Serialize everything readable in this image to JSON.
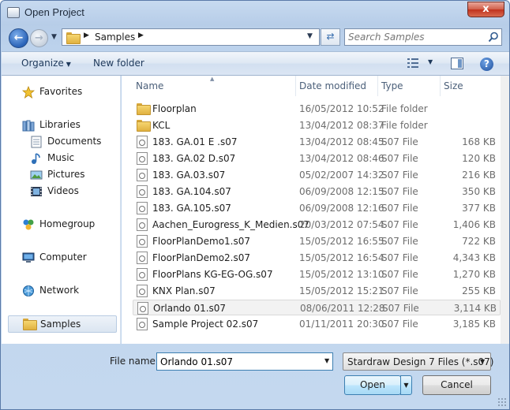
{
  "window": {
    "title": "Open Project",
    "close_label": "x"
  },
  "address": {
    "location": "Samples"
  },
  "search": {
    "placeholder": "Search Samples"
  },
  "toolbar": {
    "organize_label": "Organize",
    "new_folder_label": "New folder",
    "help_label": "?"
  },
  "nav": {
    "favorites": "Favorites",
    "libraries": "Libraries",
    "documents": "Documents",
    "music": "Music",
    "pictures": "Pictures",
    "videos": "Videos",
    "homegroup": "Homegroup",
    "computer": "Computer",
    "network": "Network",
    "samples": "Samples"
  },
  "columns": {
    "name": "Name",
    "date": "Date modified",
    "type": "Type",
    "size": "Size"
  },
  "files": [
    {
      "name": "Floorplan",
      "date": "16/05/2012 10:52",
      "type": "File folder",
      "size": "",
      "kind": "folder"
    },
    {
      "name": "KCL",
      "date": "13/04/2012 08:37",
      "type": "File folder",
      "size": "",
      "kind": "folder"
    },
    {
      "name": "183. GA.01 E .s07",
      "date": "13/04/2012 08:45",
      "type": "S07 File",
      "size": "168 KB",
      "kind": "file"
    },
    {
      "name": "183. GA.02 D.s07",
      "date": "13/04/2012 08:46",
      "type": "S07 File",
      "size": "120 KB",
      "kind": "file"
    },
    {
      "name": "183. GA.03.s07",
      "date": "05/02/2007 14:32",
      "type": "S07 File",
      "size": "216 KB",
      "kind": "file"
    },
    {
      "name": "183. GA.104.s07",
      "date": "06/09/2008 12:15",
      "type": "S07 File",
      "size": "350 KB",
      "kind": "file"
    },
    {
      "name": "183. GA.105.s07",
      "date": "06/09/2008 12:16",
      "type": "S07 File",
      "size": "377 KB",
      "kind": "file"
    },
    {
      "name": "Aachen_Eurogress_K_Medien.s07",
      "date": "20/03/2012 07:54",
      "type": "S07 File",
      "size": "1,406 KB",
      "kind": "file"
    },
    {
      "name": "FloorPlanDemo1.s07",
      "date": "15/05/2012 16:55",
      "type": "S07 File",
      "size": "722 KB",
      "kind": "file"
    },
    {
      "name": "FloorPlanDemo2.s07",
      "date": "15/05/2012 16:54",
      "type": "S07 File",
      "size": "4,343 KB",
      "kind": "file"
    },
    {
      "name": "FloorPlans KG-EG-OG.s07",
      "date": "15/05/2012 13:10",
      "type": "S07 File",
      "size": "1,270 KB",
      "kind": "file"
    },
    {
      "name": "KNX Plan.s07",
      "date": "15/05/2012 15:21",
      "type": "S07 File",
      "size": "255 KB",
      "kind": "file"
    },
    {
      "name": "Orlando 01.s07",
      "date": "08/06/2011 12:28",
      "type": "S07 File",
      "size": "3,114 KB",
      "kind": "file",
      "selected": true
    },
    {
      "name": "Sample Project 02.s07",
      "date": "01/11/2011 20:30",
      "type": "S07 File",
      "size": "3,185 KB",
      "kind": "file"
    }
  ],
  "footer": {
    "file_name_label": "File name:",
    "file_name_value": "Orlando 01.s07",
    "file_type_value": "Stardraw Design 7 Files (*.s07)",
    "open_label": "Open",
    "cancel_label": "Cancel"
  }
}
